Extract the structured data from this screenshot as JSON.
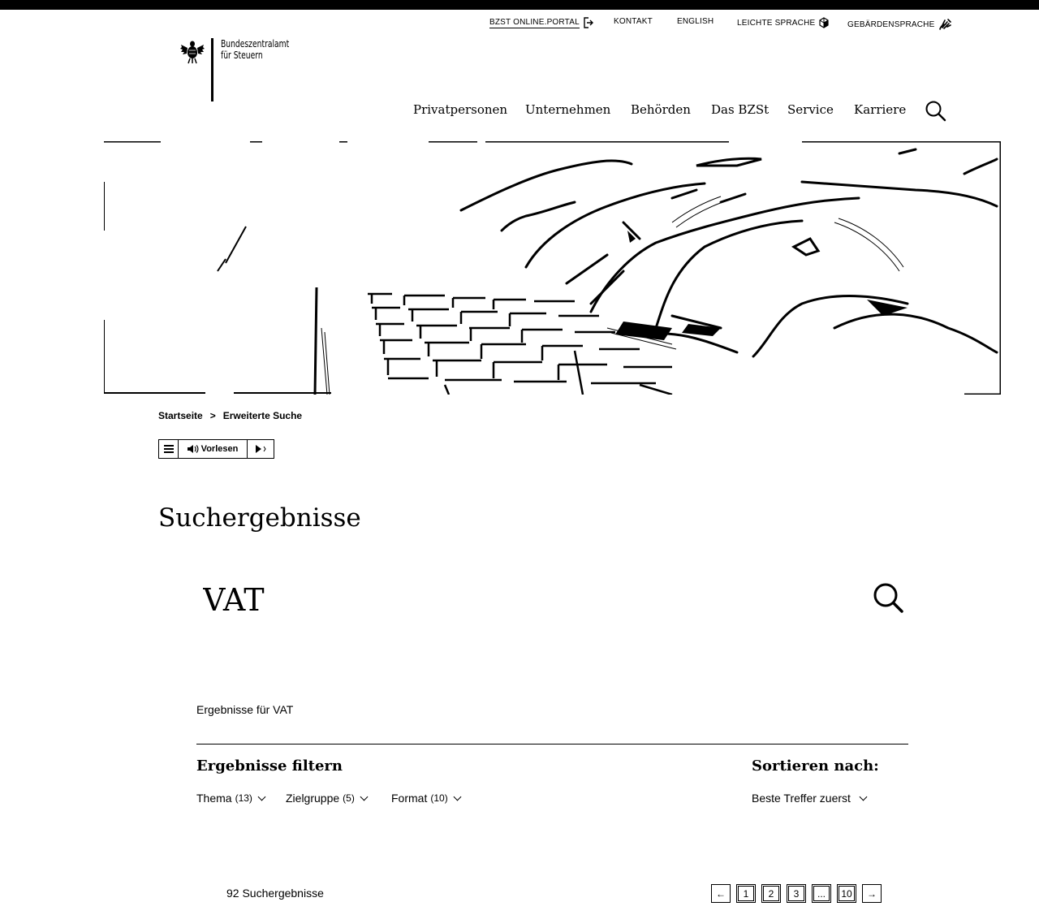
{
  "meta_nav": {
    "portal": "BZST ONLINE.PORTAL",
    "contact": "KONTAKT",
    "english": "ENGLISH",
    "easy_language": "LEICHTE SPRACHE",
    "sign_language": "GEBÄRDENSPRACHE"
  },
  "logo": {
    "line1": "Bundeszentralamt",
    "line2": "für Steuern"
  },
  "main_nav": {
    "items": [
      "Privatpersonen",
      "Unternehmen",
      "Behörden",
      "Das BZSt",
      "Service",
      "Karriere"
    ]
  },
  "breadcrumb": {
    "home": "Startseite",
    "separator": ">",
    "current": "Erweiterte Suche"
  },
  "readspeaker": {
    "read_label": "Vorlesen"
  },
  "page": {
    "title": "Suchergebnisse"
  },
  "search": {
    "value": "VAT"
  },
  "results": {
    "for_label": "Ergebnisse für VAT",
    "filter_title": "Ergebnisse filtern",
    "sort_title": "Sortieren nach:",
    "filters": [
      {
        "label": "Thema",
        "count": "(13)"
      },
      {
        "label": "Zielgruppe",
        "count": "(5)"
      },
      {
        "label": "Format",
        "count": "(10)"
      }
    ],
    "sort_value": "Beste Treffer zuerst",
    "total_label": "92 Suchergebnisse"
  },
  "pagination": {
    "prev": "←",
    "pages": [
      "1",
      "2",
      "3",
      "...",
      "10"
    ],
    "next": "→"
  }
}
